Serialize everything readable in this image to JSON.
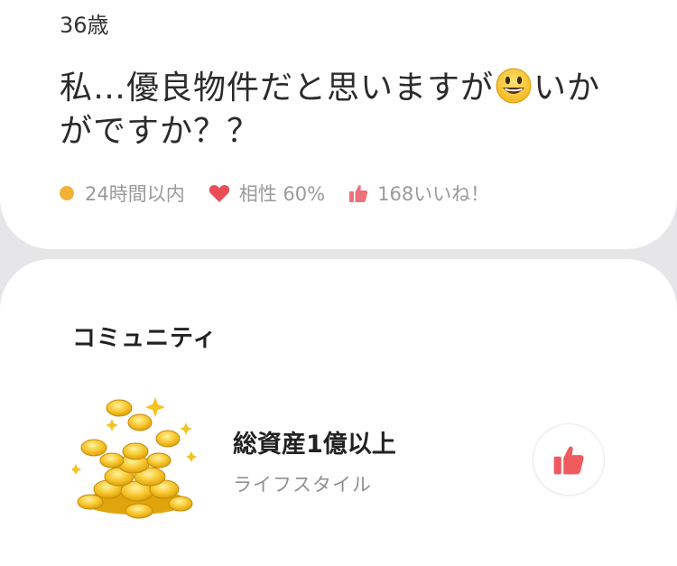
{
  "profile": {
    "age": "36歳",
    "message_part1": "私…優良物件だと思いますが",
    "message_part2": "いかがですか？？",
    "emoji_name": "grinning-face-emoji"
  },
  "meta": {
    "login": "24時間以内",
    "compatibility": "相性 60%",
    "likes": "168いいね！"
  },
  "community": {
    "section_title": "コミュニティ",
    "name": "総資産1億以上",
    "category": "ライフスタイル"
  },
  "colors": {
    "online_dot": "#f2b23a",
    "heart": "#e84d58",
    "thumb": "#f07078",
    "like_button_thumb": "#ef5a5f"
  },
  "icons": {
    "online": "online-status-dot",
    "compat": "heart-icon",
    "likes": "thumbs-up-icon",
    "community_image": "gold-coins-image",
    "like_button": "thumbs-up-icon"
  }
}
